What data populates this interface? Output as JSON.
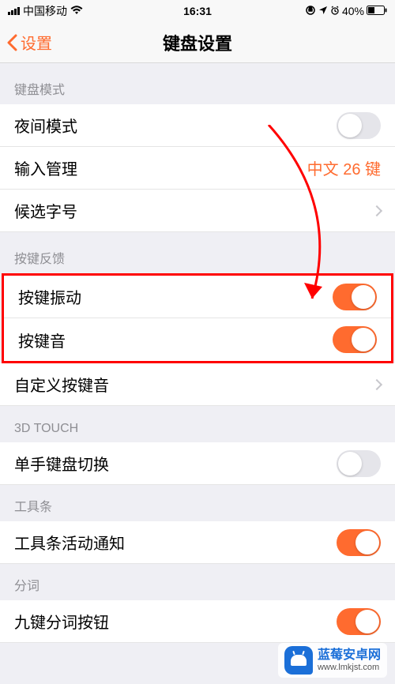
{
  "status": {
    "carrier": "中国移动",
    "time": "16:31",
    "battery": "40%"
  },
  "nav": {
    "back": "设置",
    "title": "键盘设置"
  },
  "sections": {
    "keyboardMode": {
      "header": "键盘模式",
      "nightMode": {
        "label": "夜间模式",
        "on": false
      },
      "inputMgmt": {
        "label": "输入管理",
        "value": "中文 26 键"
      },
      "candidateSize": {
        "label": "候选字号"
      }
    },
    "feedback": {
      "header": "按键反馈",
      "vibrate": {
        "label": "按键振动",
        "on": true
      },
      "sound": {
        "label": "按键音",
        "on": true
      },
      "customSound": {
        "label": "自定义按键音"
      }
    },
    "touch3d": {
      "header": "3D TOUCH",
      "oneHand": {
        "label": "单手键盘切换",
        "on": false
      }
    },
    "toolbar": {
      "header": "工具条",
      "activity": {
        "label": "工具条活动通知",
        "on": true
      }
    },
    "segment": {
      "header": "分词",
      "nineKey": {
        "label": "九键分词按钮",
        "on": true
      }
    }
  },
  "watermark": {
    "title": "蓝莓安卓网",
    "url": "www.lmkjst.com"
  }
}
